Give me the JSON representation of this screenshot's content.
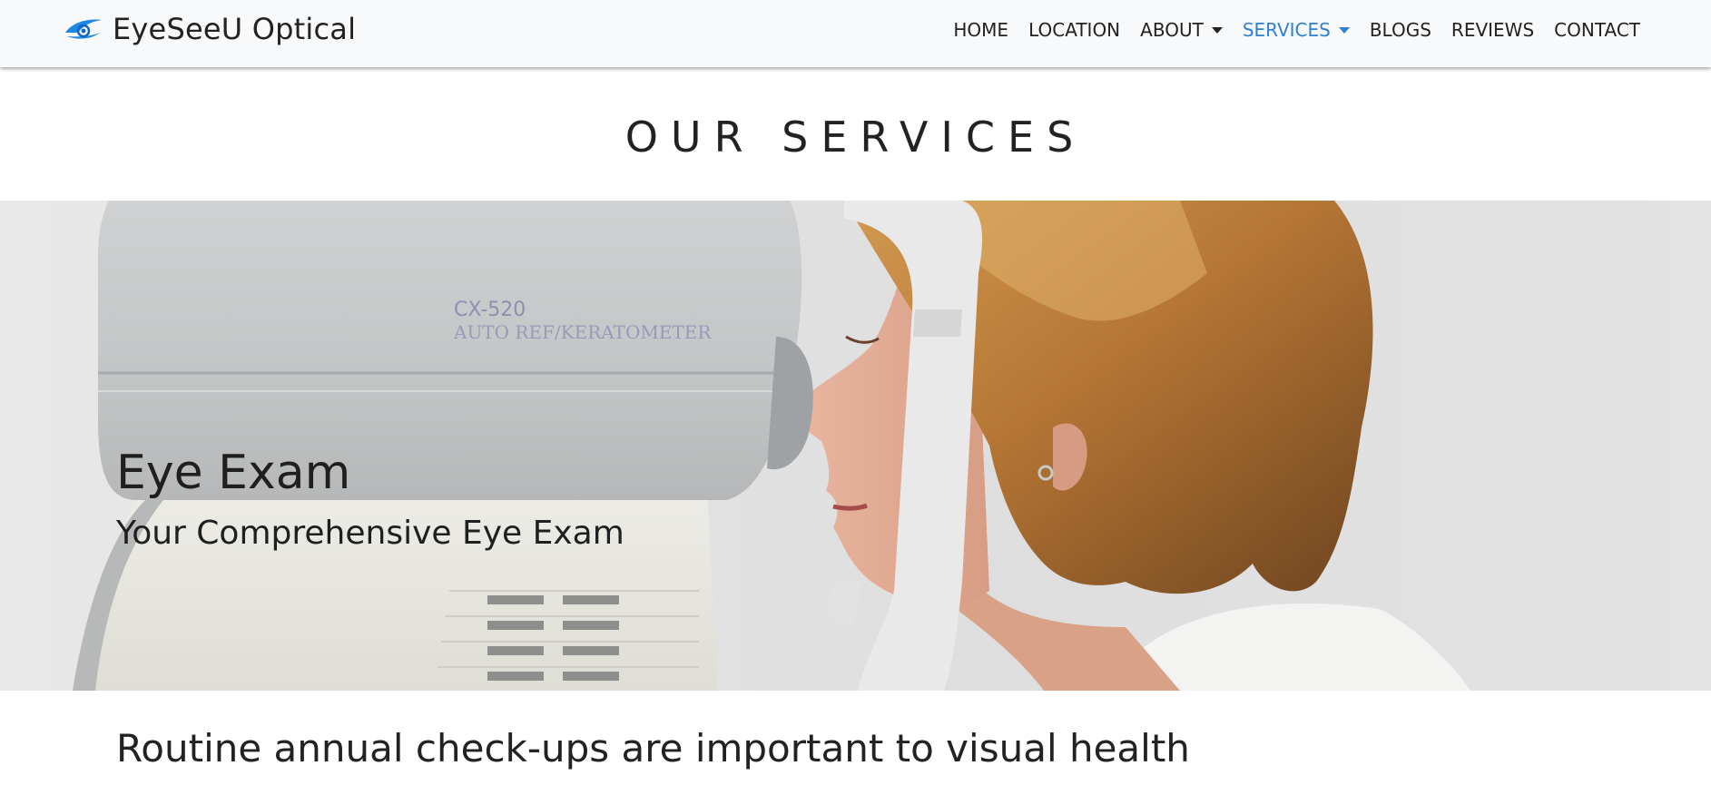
{
  "brand": {
    "name": "EyeSeeU Optical",
    "logo_icon": "eye-swoosh-icon",
    "logo_color": "#1e88e5"
  },
  "nav": {
    "items": [
      {
        "label": "HOME",
        "dropdown": false,
        "active": false
      },
      {
        "label": "LOCATION",
        "dropdown": false,
        "active": false
      },
      {
        "label": "ABOUT",
        "dropdown": true,
        "active": false
      },
      {
        "label": "SERVICES",
        "dropdown": true,
        "active": true
      },
      {
        "label": "BLOGS",
        "dropdown": false,
        "active": false
      },
      {
        "label": "REVIEWS",
        "dropdown": false,
        "active": false
      },
      {
        "label": "CONTACT",
        "dropdown": false,
        "active": false
      }
    ],
    "active_color": "#2f80d1"
  },
  "section": {
    "title": "OUR SERVICES"
  },
  "hero": {
    "title": "Eye Exam",
    "subtitle": "Your Comprehensive Eye Exam",
    "device_label_line1": "CX-520",
    "device_label_line2": "AUTO REF/KERATOMETER"
  },
  "content": {
    "heading": "Routine annual check-ups are important to visual health"
  }
}
